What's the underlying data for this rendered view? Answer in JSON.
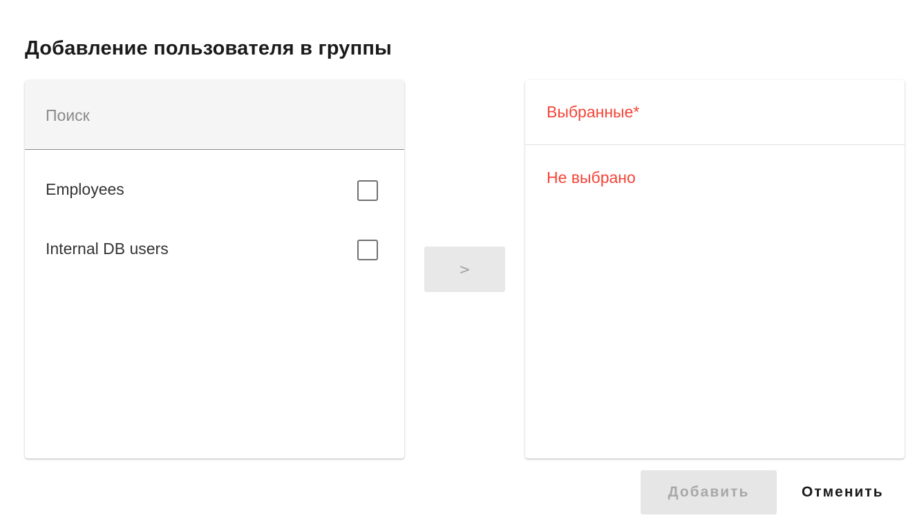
{
  "dialog": {
    "title": "Добавление пользователя в группы"
  },
  "available": {
    "search": {
      "placeholder": "Поиск",
      "value": ""
    },
    "items": [
      {
        "label": "Employees",
        "checked": false
      },
      {
        "label": "Internal DB users",
        "checked": false
      }
    ]
  },
  "transfer": {
    "label": ">"
  },
  "selected": {
    "title": "Выбранные*",
    "empty_text": "Не выбрано"
  },
  "actions": {
    "add_label": "Добавить",
    "cancel_label": "Отменить"
  },
  "colors": {
    "error": "#f44336",
    "disabled_bg": "#e6e6e6",
    "disabled_text": "#a8a8a8"
  }
}
